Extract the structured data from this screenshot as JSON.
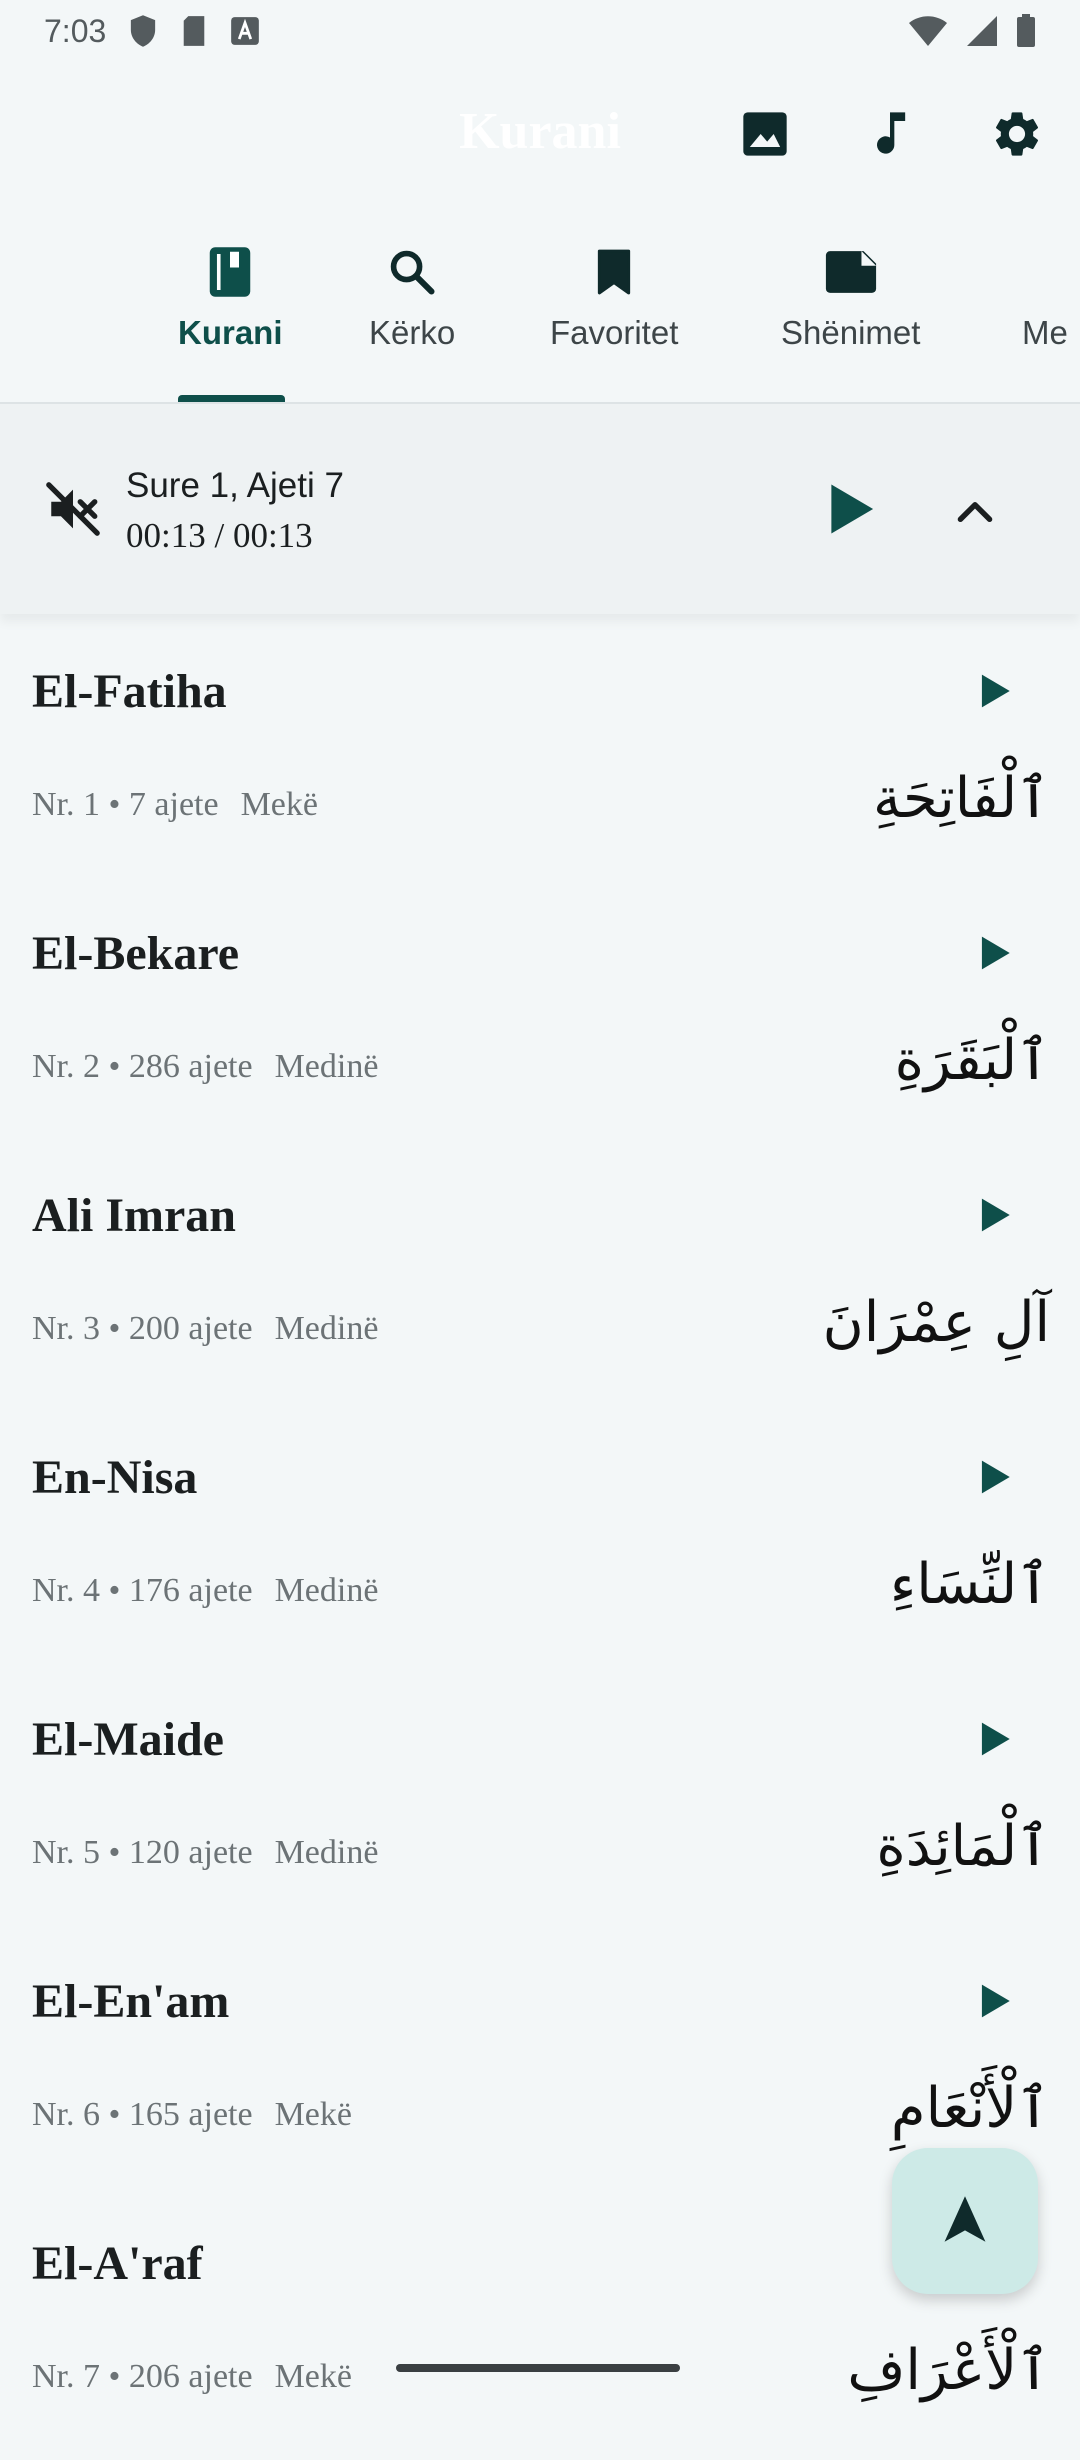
{
  "status_bar": {
    "time": "7:03"
  },
  "app_bar": {
    "title": "Kurani",
    "actions": [
      {
        "icon": "image-icon"
      },
      {
        "icon": "music-note-icon"
      },
      {
        "icon": "settings-gear-icon"
      }
    ]
  },
  "tabs": [
    {
      "label": "Kurani",
      "icon": "book-icon",
      "active": true
    },
    {
      "label": "Kërko",
      "icon": "search-icon"
    },
    {
      "label": "Favoritet",
      "icon": "bookmark-icon"
    },
    {
      "label": "Shënimet",
      "icon": "note-icon"
    },
    {
      "label": "Me",
      "icon": "more-icon"
    }
  ],
  "player": {
    "title": "Sure 1, Ajeti 7",
    "time": "00:13 / 00:13"
  },
  "surahs": [
    {
      "name": "El-Fatiha",
      "meta": "Nr. 1 • 7 ajete",
      "revelation": "Mekë",
      "arabic": "ٱلْفَاتِحَةِ"
    },
    {
      "name": "El-Bekare",
      "meta": "Nr. 2 • 286 ajete",
      "revelation": "Medinë",
      "arabic": "ٱلْبَقَرَةِ"
    },
    {
      "name": "Ali Imran",
      "meta": "Nr. 3 • 200 ajete",
      "revelation": "Medinë",
      "arabic": "آلِ عِمْرَانَ"
    },
    {
      "name": "En-Nisa",
      "meta": "Nr. 4 • 176 ajete",
      "revelation": "Medinë",
      "arabic": "ٱلنِّسَاءِ"
    },
    {
      "name": "El-Maide",
      "meta": "Nr. 5 • 120 ajete",
      "revelation": "Medinë",
      "arabic": "ٱلْمَائِدَةِ"
    },
    {
      "name": "El-En'am",
      "meta": "Nr. 6 • 165 ajete",
      "revelation": "Mekë",
      "arabic": "ٱلْأَنْعَامِ"
    },
    {
      "name": "El-A'raf",
      "meta": "Nr. 7 • 206 ajete",
      "revelation": "Mekë",
      "arabic": "ٱلْأَعْرَافِ"
    }
  ],
  "fab": {
    "icon": "navigation-arrow-icon"
  },
  "colors": {
    "accent": "#0e4f4a",
    "background": "#f3f7f8",
    "fab": "#cdeae7"
  }
}
